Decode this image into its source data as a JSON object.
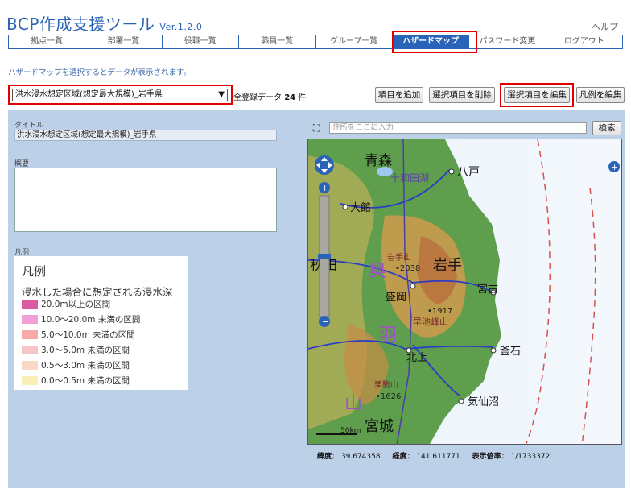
{
  "header": {
    "title": "BCP作成支援ツール",
    "version": "Ver.1.2.0",
    "help": "ヘルプ"
  },
  "nav": {
    "items": [
      "拠点一覧",
      "部署一覧",
      "役職一覧",
      "職員一覧",
      "グループ一覧",
      "ハザードマップ",
      "パスワード変更",
      "ログアウト"
    ],
    "active": "ハザードマップ"
  },
  "instruction": "ハザードマップを選択するとデータが表示されます。",
  "selector": {
    "value": "洪水浸水想定区域(想定最大規模)_岩手県",
    "count_label": "全登録データ",
    "count_value": "24",
    "count_unit": "件"
  },
  "buttons": {
    "add": "項目を追加",
    "delete": "選択項目を削除",
    "edit": "選択項目を編集",
    "legend_edit": "凡例を編集"
  },
  "form": {
    "title_label": "タイトル",
    "title_value": "洪水浸水想定区域(想定最大規模)_岩手県",
    "summary_label": "概要",
    "summary_value": "",
    "legend_label": "凡例"
  },
  "legend": {
    "heading": "凡例",
    "subtitle": "浸水した場合に想定される浸水深",
    "items": [
      {
        "label": "20.0m以上の区間",
        "color": "#dc5aa0"
      },
      {
        "label": "10.0～20.0m 未満の区間",
        "color": "#f0a0d6"
      },
      {
        "label": "5.0～10.0m 未満の区間",
        "color": "#f6aaaa"
      },
      {
        "label": "3.0～5.0m 未満の区間",
        "color": "#f9c4c4"
      },
      {
        "label": "0.5～3.0m 未満の区間",
        "color": "#fbd8c6"
      },
      {
        "label": "0.0～0.5m 未満の区間",
        "color": "#f6f0b6"
      }
    ]
  },
  "map": {
    "search_placeholder": "住所をここに入力",
    "search_button": "検索",
    "place_labels": [
      "青森",
      "十和田湖",
      "八戸",
      "大館",
      "秋田",
      "岩手山",
      "岩手",
      "•2038",
      "盛岡",
      "宮古",
      "•1917",
      "早池峰山",
      "北上",
      "釜石",
      "栗駒山",
      "•1626",
      "気仙沼",
      "宮城",
      "羽",
      "山",
      "奥"
    ],
    "scale_label": "50km",
    "lat_label": "緯度：",
    "lat_value": "39.674358",
    "lng_label": "経度：",
    "lng_value": "141.611771",
    "zoom_label": "表示倍率：",
    "zoom_value": "1/1733372"
  }
}
